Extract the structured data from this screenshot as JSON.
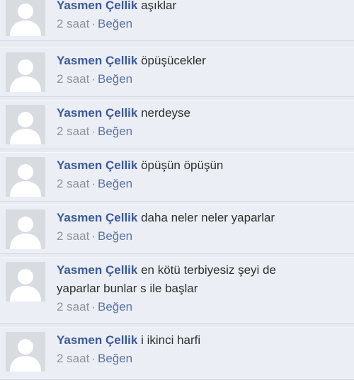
{
  "comments": [
    {
      "author": "Yasmen Çellik",
      "lines": [
        "aşıklar"
      ],
      "time": "2 saat",
      "separator": "·",
      "like": "Beğen"
    },
    {
      "author": "Yasmen Çellik",
      "lines": [
        "öpüşücekler"
      ],
      "time": "2 saat",
      "separator": "·",
      "like": "Beğen"
    },
    {
      "author": "Yasmen Çellik",
      "lines": [
        "nerdeyse"
      ],
      "time": "2 saat",
      "separator": "·",
      "like": "Beğen"
    },
    {
      "author": "Yasmen Çellik",
      "lines": [
        "öpüşün öpüşün"
      ],
      "time": "2 saat",
      "separator": "·",
      "like": "Beğen"
    },
    {
      "author": "Yasmen Çellik",
      "lines": [
        "daha neler neler yaparlar"
      ],
      "time": "2 saat",
      "separator": "·",
      "like": "Beğen"
    },
    {
      "author": "Yasmen Çellik",
      "lines": [
        "en kötü terbiyesiz şeyi de",
        "yaparlar bunlar s ile başlar"
      ],
      "time": "2 saat",
      "separator": "·",
      "like": "Beğen"
    },
    {
      "author": "Yasmen Çellik",
      "lines": [
        "i ikinci harfi"
      ],
      "time": "2 saat",
      "separator": "·",
      "like": "Beğen"
    }
  ],
  "icons": {
    "avatar": "default-profile-silhouette-icon"
  },
  "colors": {
    "author": "#3b5998",
    "meta": "#8d949e",
    "background": "#ebeef4"
  }
}
